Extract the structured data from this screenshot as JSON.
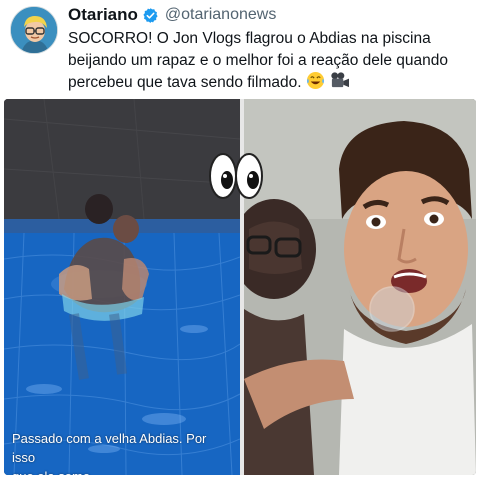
{
  "post": {
    "display_name": "Otariano",
    "handle": "@otarianonews",
    "text": "SOCORRO! O Jon Vlogs flagrou o Abdias na piscina beijando um rapaz e o melhor foi a reação dele quando percebeu que tava sendo filmado.",
    "text_emojis": [
      "laughing-crying-emoji",
      "movie-camera-emoji"
    ]
  },
  "media": {
    "caption_line1": "Passado com a velha Abdias. Por isso",
    "caption_line2": "que ela some"
  },
  "colors": {
    "verified": "#1d9bf0",
    "handle": "#536471",
    "text": "#0f1419",
    "pool": "#1a64b8"
  }
}
